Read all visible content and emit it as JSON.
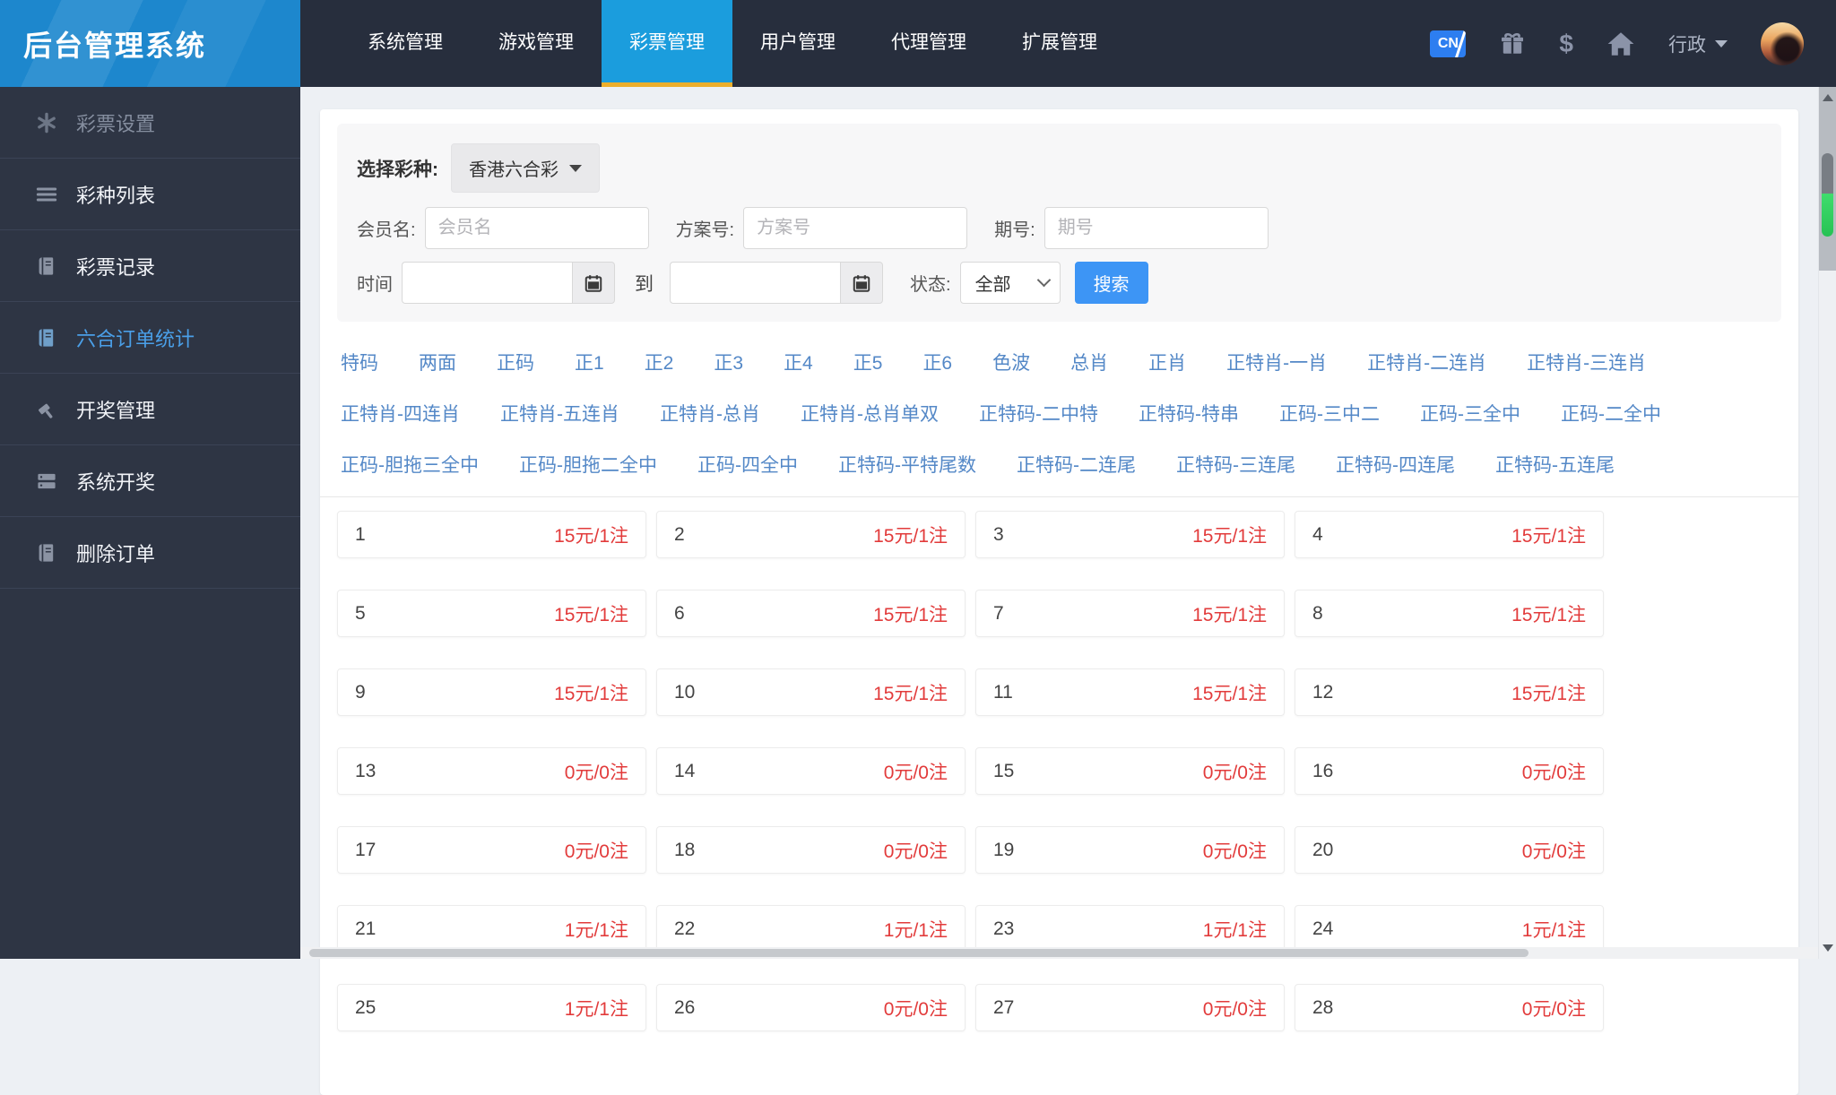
{
  "app": {
    "title": "后台管理系统"
  },
  "topbar": {
    "nav": [
      {
        "label": "系统管理",
        "active": false
      },
      {
        "label": "游戏管理",
        "active": false
      },
      {
        "label": "彩票管理",
        "active": true
      },
      {
        "label": "用户管理",
        "active": false
      },
      {
        "label": "代理管理",
        "active": false
      },
      {
        "label": "扩展管理",
        "active": false
      }
    ],
    "right": {
      "cn_badge": "CN",
      "dollar": "$",
      "username": "行政"
    }
  },
  "sidebar": [
    {
      "label": "彩票设置",
      "icon": "asterisk-icon",
      "state": "dim"
    },
    {
      "label": "彩种列表",
      "icon": "list-icon",
      "state": "normal"
    },
    {
      "label": "彩票记录",
      "icon": "book-icon",
      "state": "normal"
    },
    {
      "label": "六合订单统计",
      "icon": "book-icon",
      "state": "active"
    },
    {
      "label": "开奖管理",
      "icon": "gavel-icon",
      "state": "normal"
    },
    {
      "label": "系统开奖",
      "icon": "server-icon",
      "state": "normal"
    },
    {
      "label": "删除订单",
      "icon": "book-icon",
      "state": "normal"
    }
  ],
  "filters": {
    "lottery_label": "选择彩种:",
    "lottery_value": "香港六合彩",
    "member_label": "会员名:",
    "member_placeholder": "会员名",
    "plan_label": "方案号:",
    "plan_placeholder": "方案号",
    "issue_label": "期号:",
    "issue_placeholder": "期号",
    "time_label": "时间",
    "to_label": "到",
    "status_label": "状态:",
    "status_value": "全部",
    "search_label": "搜索"
  },
  "bet_tabs": {
    "row1": [
      "特码",
      "两面",
      "正码",
      "正1",
      "正2",
      "正3",
      "正4",
      "正5",
      "正6",
      "色波",
      "总肖",
      "正肖",
      "正特肖-一肖",
      "正特肖-二连肖",
      "正特肖-三连肖"
    ],
    "row2": [
      "正特肖-四连肖",
      "正特肖-五连肖",
      "正特肖-总肖",
      "正特肖-总肖单双",
      "正特码-二中特",
      "正特码-特串",
      "正码-三中二",
      "正码-三全中",
      "正码-二全中"
    ],
    "row3": [
      "正码-胆拖三全中",
      "正码-胆拖二全中",
      "正码-四全中",
      "正特码-平特尾数",
      "正特码-二连尾",
      "正特码-三连尾",
      "正特码-四连尾",
      "正特码-五连尾"
    ]
  },
  "stats_cells": [
    {
      "num": "1",
      "value": "15元/1注"
    },
    {
      "num": "2",
      "value": "15元/1注"
    },
    {
      "num": "3",
      "value": "15元/1注"
    },
    {
      "num": "4",
      "value": "15元/1注"
    },
    {
      "num": "5",
      "value": "15元/1注"
    },
    {
      "num": "6",
      "value": "15元/1注"
    },
    {
      "num": "7",
      "value": "15元/1注"
    },
    {
      "num": "8",
      "value": "15元/1注"
    },
    {
      "num": "9",
      "value": "15元/1注"
    },
    {
      "num": "10",
      "value": "15元/1注"
    },
    {
      "num": "11",
      "value": "15元/1注"
    },
    {
      "num": "12",
      "value": "15元/1注"
    },
    {
      "num": "13",
      "value": "0元/0注"
    },
    {
      "num": "14",
      "value": "0元/0注"
    },
    {
      "num": "15",
      "value": "0元/0注"
    },
    {
      "num": "16",
      "value": "0元/0注"
    },
    {
      "num": "17",
      "value": "0元/0注"
    },
    {
      "num": "18",
      "value": "0元/0注"
    },
    {
      "num": "19",
      "value": "0元/0注"
    },
    {
      "num": "20",
      "value": "0元/0注"
    },
    {
      "num": "21",
      "value": "1元/1注"
    },
    {
      "num": "22",
      "value": "1元/1注"
    },
    {
      "num": "23",
      "value": "1元/1注"
    },
    {
      "num": "24",
      "value": "1元/1注"
    },
    {
      "num": "25",
      "value": "1元/1注"
    },
    {
      "num": "26",
      "value": "0元/0注"
    },
    {
      "num": "27",
      "value": "0元/0注"
    },
    {
      "num": "28",
      "value": "0元/0注"
    }
  ],
  "colors": {
    "topbar_bg": "#272e3d",
    "logo_bg": "#1d87cd",
    "active_tab_bg": "#1b9ddd",
    "active_tab_underline": "#ecae2b",
    "sidebar_bg": "#2e3544",
    "sidebar_active_text": "#4a9fe8",
    "link_blue": "#5488c7",
    "value_red": "#e23b3b",
    "search_button": "#3d95f5",
    "scroll_thumb_green": "#2fcf5f"
  }
}
